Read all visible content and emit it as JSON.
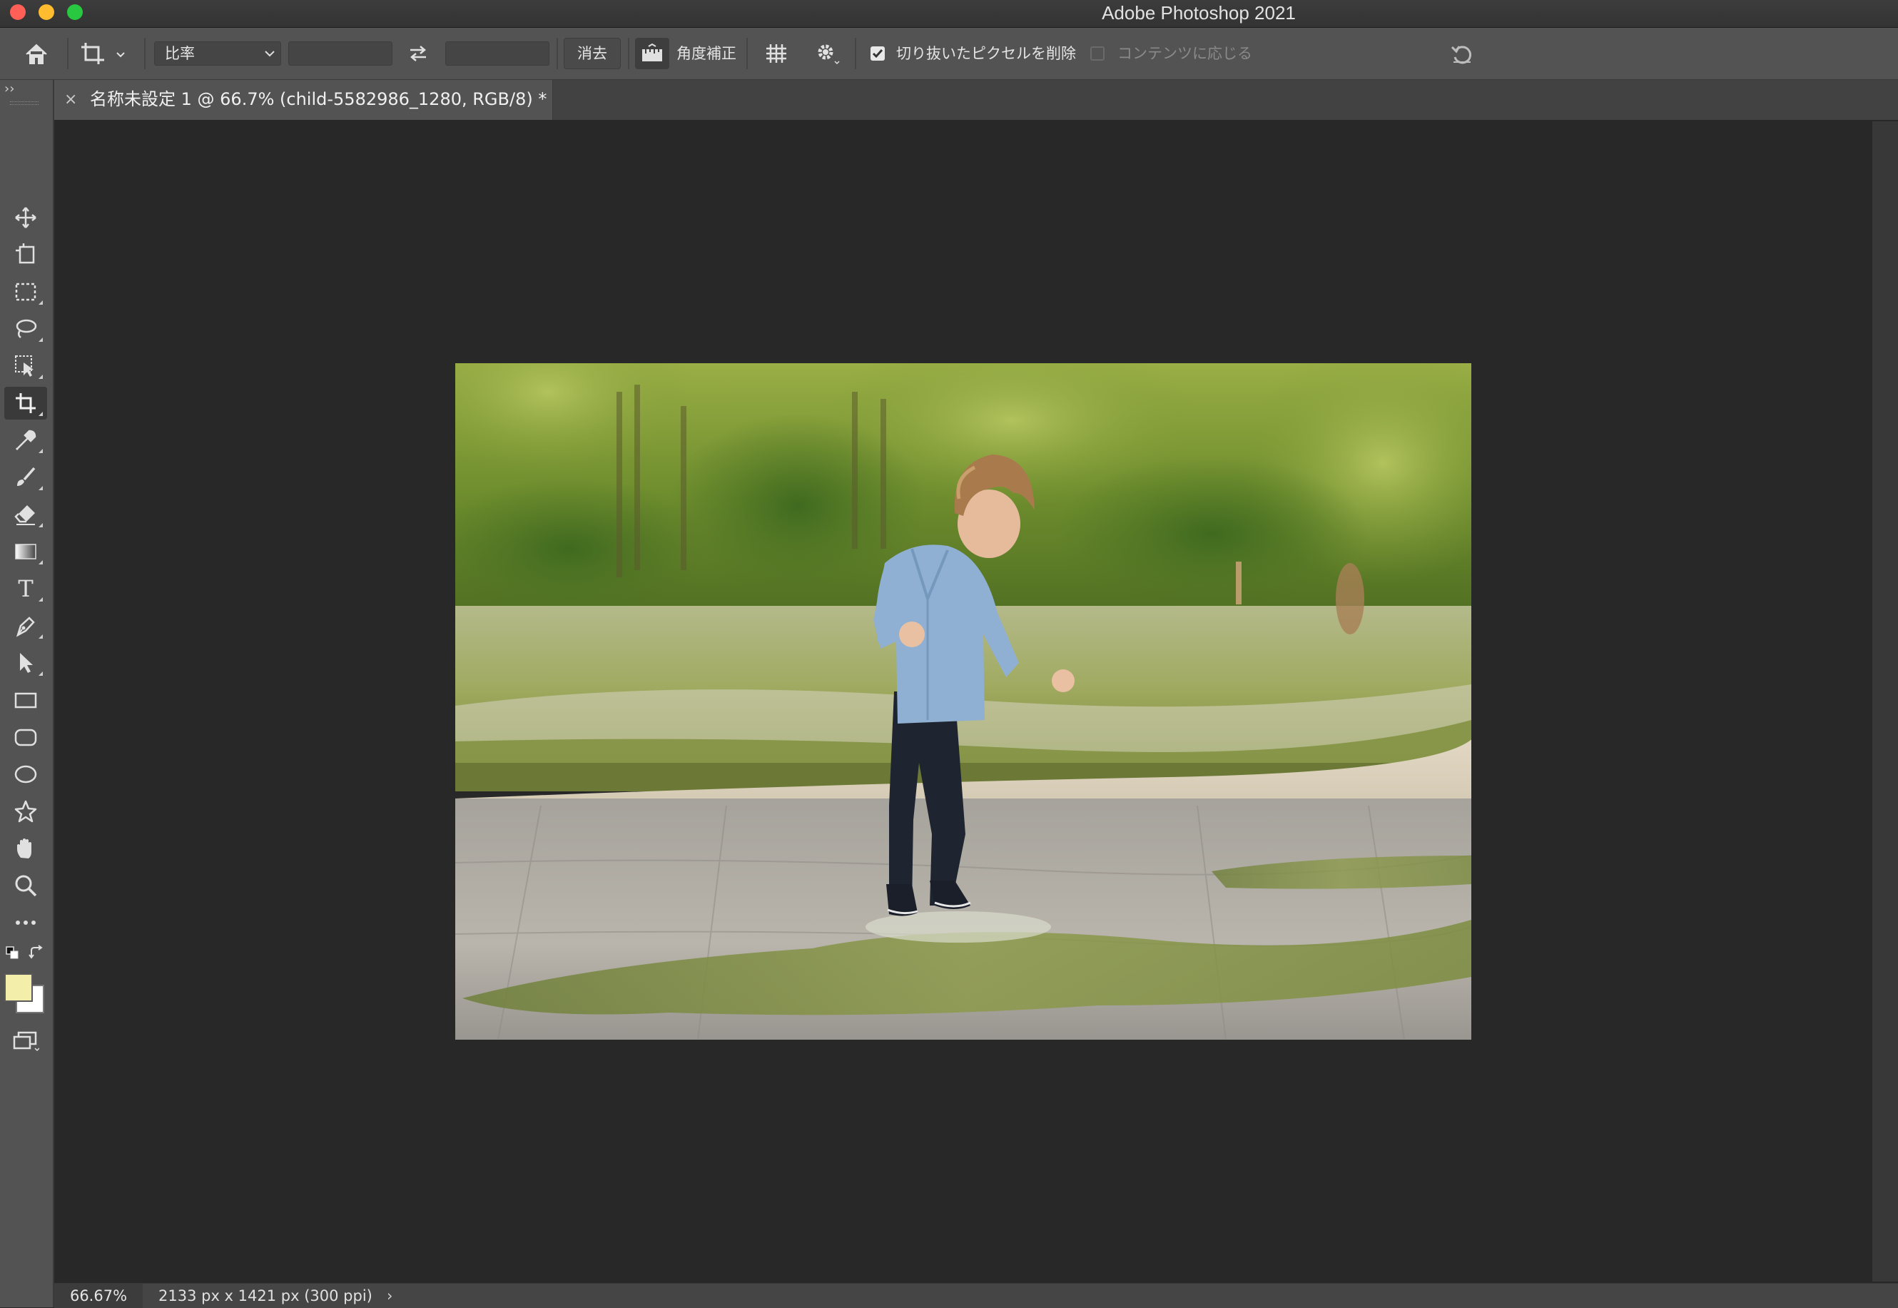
{
  "window": {
    "title": "Adobe Photoshop 2021",
    "traffic_lights": [
      "#fe5f57",
      "#febc2e",
      "#28c840"
    ]
  },
  "options_bar": {
    "ratio_preset": "比率",
    "width_value": "",
    "height_value": "",
    "clear_label": "消去",
    "straighten_label": "角度補正",
    "delete_cropped_label": "切り抜いたピクセルを削除",
    "delete_cropped_checked": true,
    "content_aware_label": "コンテンツに応じる",
    "content_aware_checked": false
  },
  "toolbar": {
    "tools": [
      "move-tool",
      "artboard-tool",
      "rectangular-marquee-tool",
      "lasso-tool",
      "object-selection-tool",
      "crop-tool",
      "eyedropper-tool",
      "brush-tool",
      "eraser-tool",
      "gradient-tool",
      "type-tool",
      "pen-tool",
      "path-selection-tool",
      "rectangle-tool",
      "rounded-rectangle-tool",
      "ellipse-tool",
      "custom-shape-tool",
      "hand-tool",
      "zoom-tool",
      "edit-toolbar"
    ],
    "active_tool": "crop-tool",
    "type_tool_glyph": "T",
    "foreground_color": "#f3efaa",
    "background_color": "#ffffff"
  },
  "document": {
    "tab_title": "名称未設定 1 @ 66.7% (child-5582986_1280, RGB/8) *",
    "close_glyph": "×"
  },
  "status_bar": {
    "zoom": "66.67%",
    "doc_info": "2133 px x 1421 px (300 ppi)",
    "arrow": "›"
  },
  "colors": {
    "app_background": "#282828",
    "panel": "#535353",
    "accent_active": "#3a3a3a"
  }
}
